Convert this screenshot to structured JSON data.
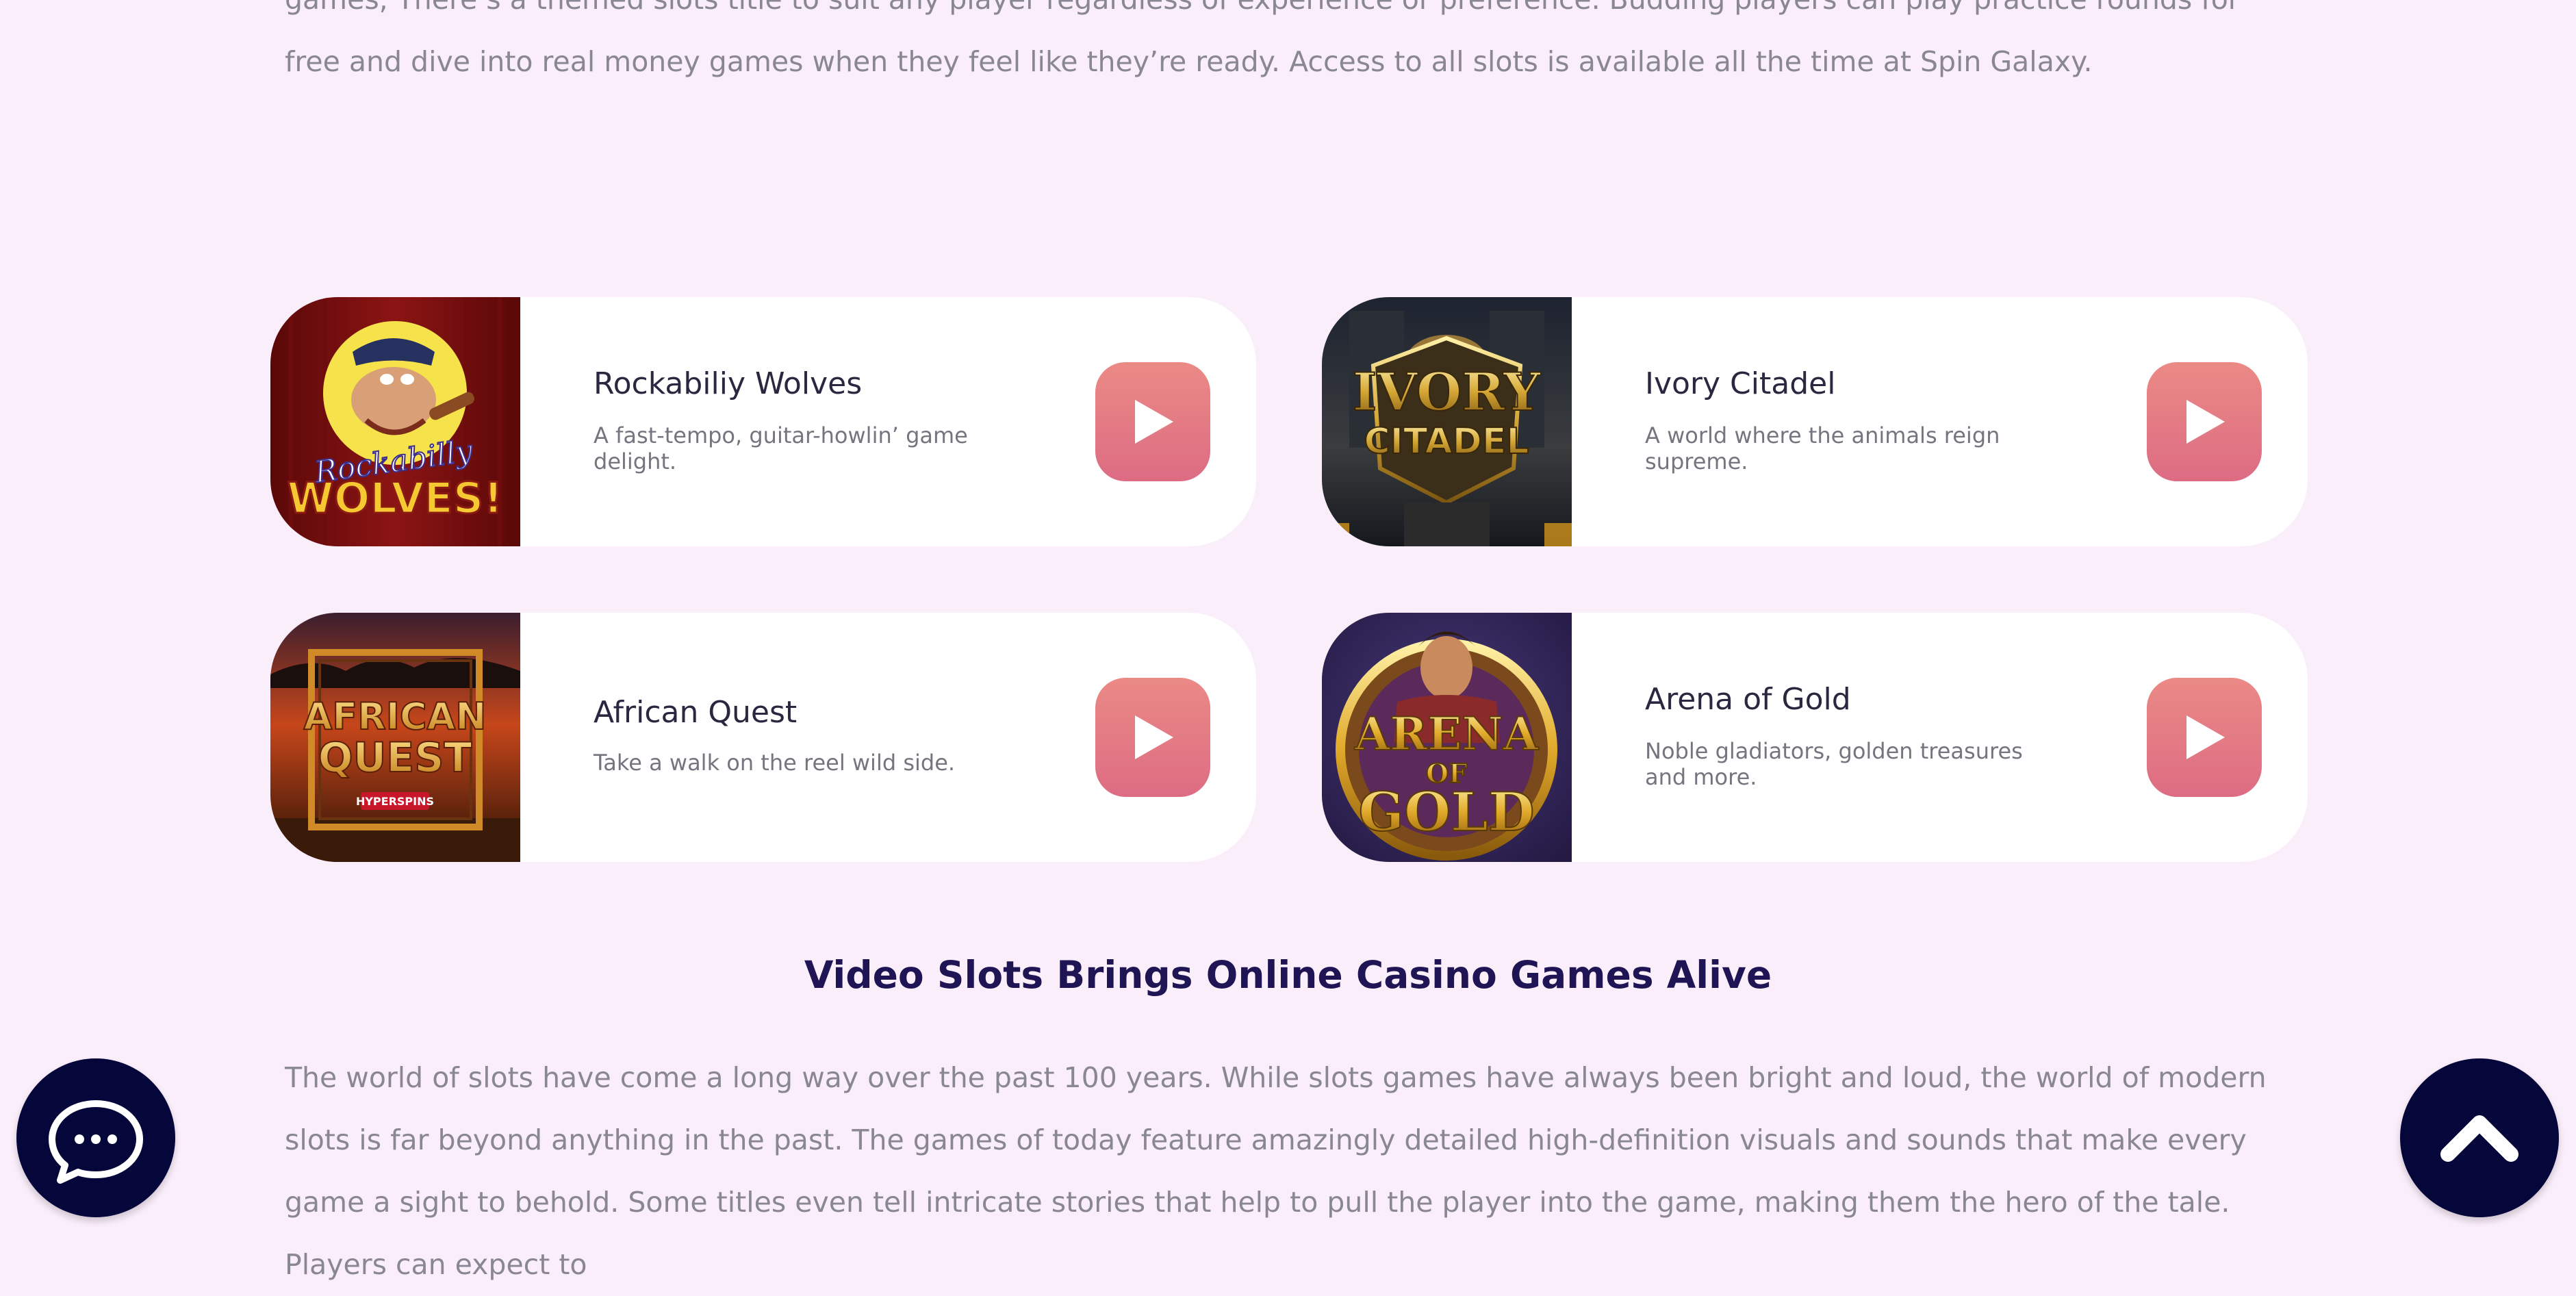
{
  "intro": {
    "text": "games, There’s a themed slots title to suit any player regardless of experience or preference. Budding players can play practice rounds for free and dive into real money games when they feel like they’re ready. Access to all slots is available all the time at Spin Galaxy."
  },
  "games": [
    {
      "title": "Rockabiliy Wolves",
      "description": "A fast-tempo, guitar-howlin’ game delight.",
      "thumb_text": [
        "Rockabilly",
        "WOLVES!"
      ],
      "icon": "play-icon"
    },
    {
      "title": "Ivory Citadel",
      "description": "A world where the animals reign supreme.",
      "thumb_text": [
        "IVORY",
        "CITADEL"
      ],
      "icon": "play-icon"
    },
    {
      "title": "African Quest",
      "description": "Take a walk on the reel wild side.",
      "thumb_text": [
        "AFRICAN",
        "QUEST",
        "HYPERSPINS"
      ],
      "icon": "play-icon"
    },
    {
      "title": "Arena of Gold",
      "description": "Noble gladiators, golden treasures and more.",
      "thumb_text": [
        "ARENA",
        "OF",
        "GOLD"
      ],
      "icon": "play-icon"
    }
  ],
  "section": {
    "heading": "Video Slots Brings Online Casino Games Alive",
    "text": "The world of slots have come a long way over the past 100 years. While slots games have always been bright and loud, the world of modern slots is far beyond anything in the past. The games of today feature amazingly detailed high-definition visuals and sounds that make every game a sight to behold. Some titles even tell intricate stories that help to pull the player into the game, making them the hero of the tale. Players can expect to"
  },
  "floating": {
    "chat_icon": "chat-bubble-icon",
    "scroll_icon": "chevron-up-icon"
  },
  "colors": {
    "background": "#fbeefb",
    "card": "#ffffff",
    "play_button_top": "#ea8a85",
    "play_button_bottom": "#dd6c83",
    "heading": "#1f1554",
    "body_text": "#8a8794",
    "round_button": "#05063a"
  }
}
